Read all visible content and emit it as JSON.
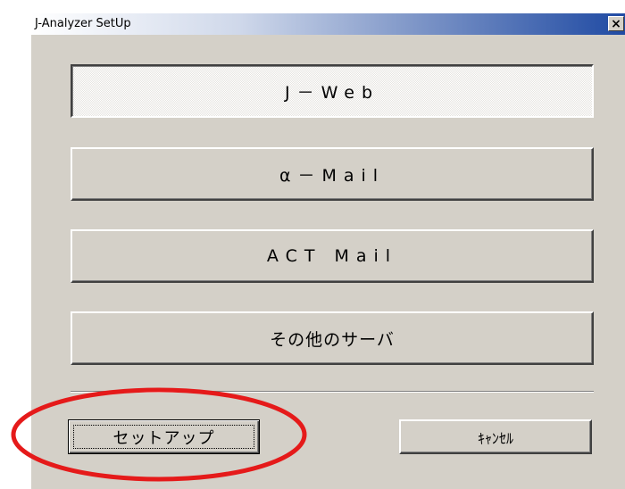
{
  "window": {
    "title": "J-Analyzer SetUp",
    "close_glyph": "×"
  },
  "buttons": {
    "jweb": "J－Web",
    "alpha_mail": "α－Mail",
    "act_mail": "ACT Mail",
    "other_server": "その他のサーバ",
    "setup": "セットアップ",
    "cancel": "ｷｬﾝｾﾙ"
  },
  "annotation": {
    "shape": "ellipse",
    "color": "#e51a1a",
    "target": "setup-button"
  }
}
